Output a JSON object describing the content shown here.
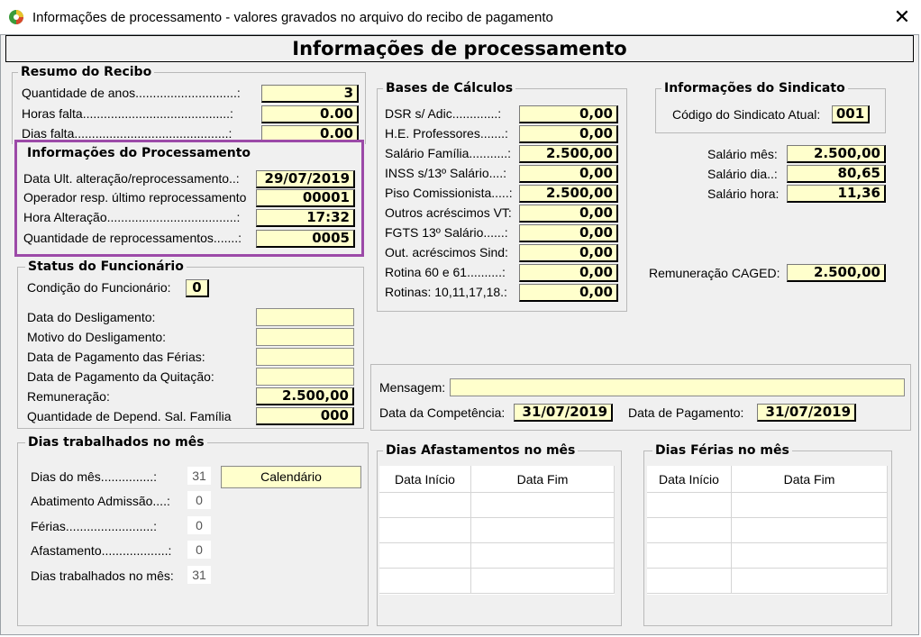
{
  "window": {
    "title": "Informações de processamento - valores gravados no arquivo do recibo de pagamento",
    "close": "✕",
    "header": "Informações de processamento"
  },
  "resumo": {
    "title": "Resumo do Recibo",
    "rows": [
      {
        "label": "Quantidade de anos.............................:",
        "value": "3"
      },
      {
        "label": "Horas falta..........................................:",
        "value": "0.00"
      },
      {
        "label": "Dias falta............................................:",
        "value": "0.00"
      }
    ]
  },
  "processamento": {
    "title": "Informações do Processamento",
    "rows": [
      {
        "label": "Data Ult. alteração/reprocessamento..:",
        "value": "29/07/2019"
      },
      {
        "label": "Operador resp. último reprocessamento",
        "value": "00001"
      },
      {
        "label": "Hora Alteração.....................................:",
        "value": "17:32"
      },
      {
        "label": "Quantidade de reprocessamentos.......:",
        "value": "0005"
      }
    ]
  },
  "status": {
    "title": "Status do Funcionário",
    "condicao_label": "Condição do Funcionário:",
    "condicao_value": "0",
    "rows": [
      {
        "label": "Data do Desligamento:",
        "value": ""
      },
      {
        "label": "Motivo do Desligamento:",
        "value": ""
      },
      {
        "label": "Data de Pagamento das Férias:",
        "value": ""
      },
      {
        "label": "Data de Pagamento da Quitação:",
        "value": ""
      },
      {
        "label": "Remuneração:",
        "value": "2.500,00"
      },
      {
        "label": "Quantidade de Depend. Sal. Família",
        "value": "000"
      }
    ]
  },
  "bases": {
    "title": "Bases de Cálculos",
    "rows": [
      {
        "label": "DSR s/ Adic.............:",
        "value": "0,00"
      },
      {
        "label": "H.E. Professores.......:",
        "value": "0,00"
      },
      {
        "label": "Salário Família...........:",
        "value": "2.500,00"
      },
      {
        "label": "INSS s/13º Salário....:",
        "value": "0,00"
      },
      {
        "label": "Piso Comissionista.....:",
        "value": "2.500,00"
      },
      {
        "label": "Outros acréscimos VT:",
        "value": "0,00"
      },
      {
        "label": "FGTS 13º Salário......:",
        "value": "0,00"
      },
      {
        "label": "Out. acréscimos Sind:",
        "value": "0,00"
      },
      {
        "label": "Rotina 60 e 61..........:",
        "value": "0,00"
      },
      {
        "label": "Rotinas: 10,11,17,18.:",
        "value": "0,00"
      }
    ]
  },
  "sindicato": {
    "title": "Informações do Sindicato",
    "codigo_label": "Código do Sindicato Atual:",
    "codigo_value": "001",
    "salarios": [
      {
        "label": "Salário mês:",
        "value": "2.500,00"
      },
      {
        "label": "Salário dia..:",
        "value": "80,65"
      },
      {
        "label": "Salário hora:",
        "value": "11,36"
      }
    ],
    "caged_label": "Remuneração CAGED:",
    "caged_value": "2.500,00"
  },
  "mensagem": {
    "label": "Mensagem:",
    "value": "",
    "competencia_label": "Data da Competência:",
    "competencia_value": "31/07/2019",
    "pagamento_label": "Data de Pagamento:",
    "pagamento_value": "31/07/2019"
  },
  "dias": {
    "title": "Dias trabalhados no mês",
    "calendario": "Calendário",
    "rows": [
      {
        "label": "Dias do mês...............:",
        "value": "31"
      },
      {
        "label": "Abatimento Admissão....:",
        "value": "0"
      },
      {
        "label": "Férias.........................:",
        "value": "0"
      },
      {
        "label": "Afastamento...................:",
        "value": "0"
      },
      {
        "label": "Dias trabalhados no mês:",
        "value": "31"
      }
    ]
  },
  "afastamentos": {
    "title": "Dias Afastamentos no mês",
    "col1": "Data Início",
    "col2": "Data Fim"
  },
  "ferias": {
    "title": "Dias Férias no mês",
    "col1": "Data Início",
    "col2": "Data Fim"
  },
  "colors": {
    "field_bg": "#ffffcc",
    "highlight": "#9c4aa8",
    "window_bg": "#f0f0f0"
  }
}
